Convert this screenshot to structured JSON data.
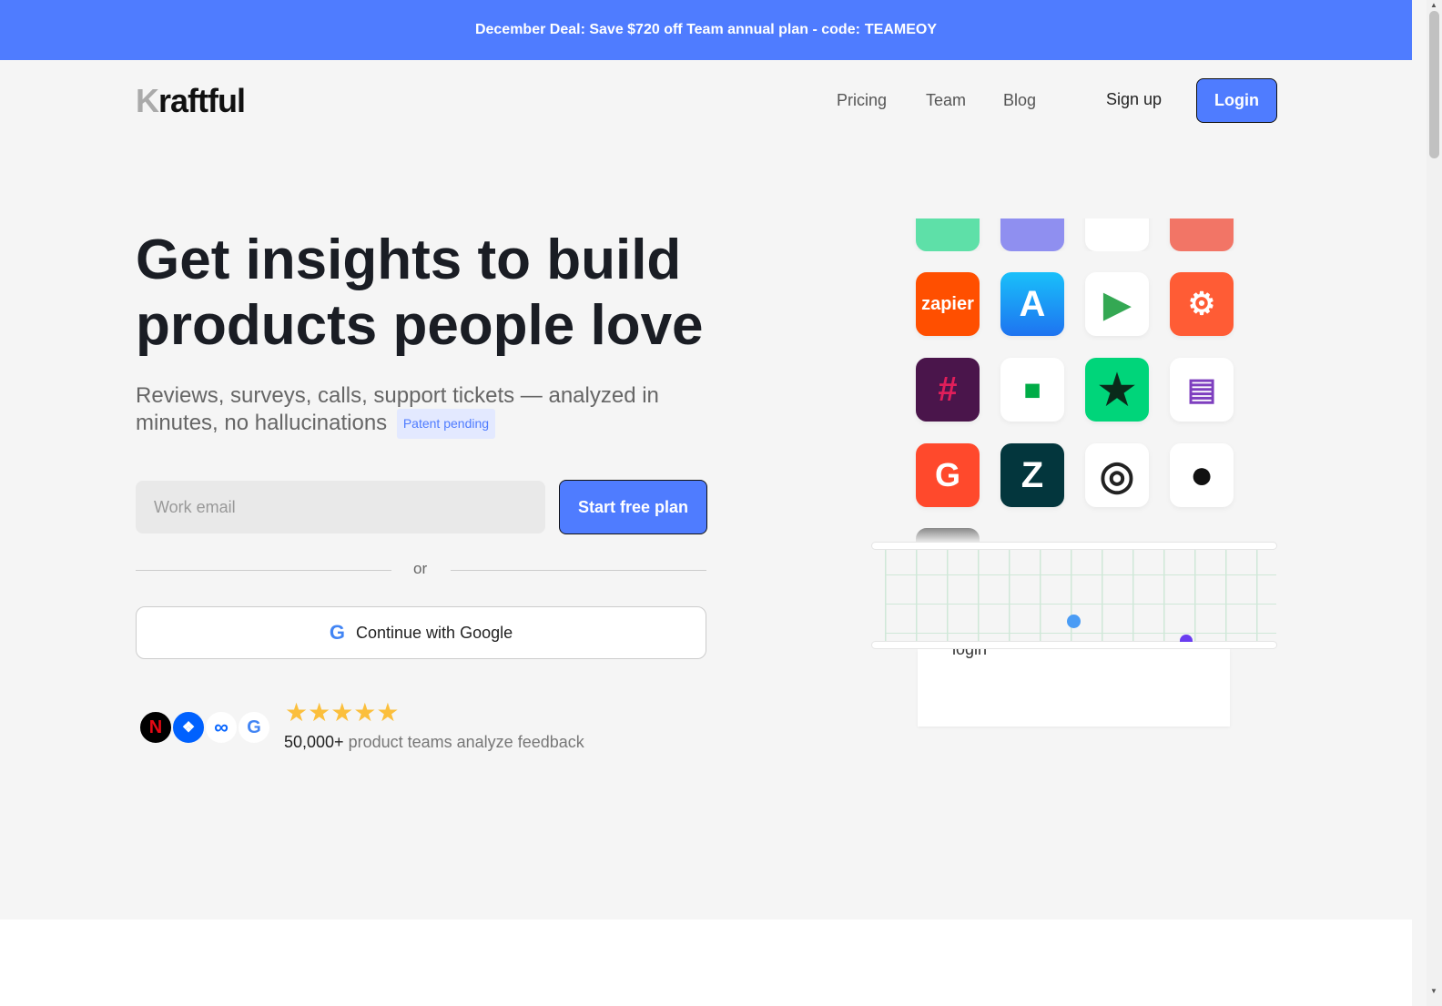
{
  "banner": {
    "text": "December Deal: Save $720 off Team annual plan - code:",
    "code": "TEAMEOY"
  },
  "header": {
    "logo_first": "K",
    "logo_rest": "raftful",
    "nav": [
      "Pricing",
      "Team",
      "Blog"
    ],
    "signup": "Sign up",
    "login": "Login"
  },
  "hero": {
    "title": "Get insights to build products people love",
    "subtitle": "Reviews, surveys, calls, support tickets — analyzed in minutes, no hallucinations",
    "badge": "Patent pending",
    "email_placeholder": "Work email",
    "start_button": "Start free plan",
    "or": "or",
    "google_button": "Continue with Google",
    "rating_stars": 5,
    "proof_count": "50,000+",
    "proof_text": "product teams analyze feedback"
  },
  "integrations": {
    "zapier_label": "zapier",
    "card_text": "login"
  },
  "colors": {
    "accent": "#4f7cff"
  }
}
